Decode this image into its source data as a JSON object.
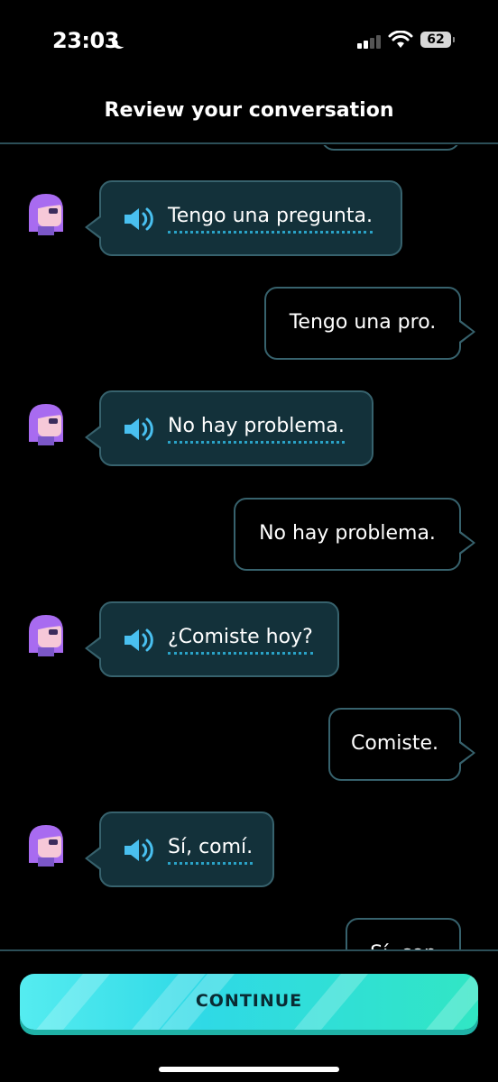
{
  "status_bar": {
    "time": "23:03",
    "battery": "62"
  },
  "header": {
    "title": "Review your conversation"
  },
  "messages": [
    {
      "side": "right",
      "text": ""
    },
    {
      "side": "left",
      "text": "Tengo una pregunta."
    },
    {
      "side": "right",
      "text": "Tengo una pro."
    },
    {
      "side": "left",
      "text": "No hay problema."
    },
    {
      "side": "right",
      "text": "No hay problema."
    },
    {
      "side": "left",
      "text": "¿Comiste hoy?"
    },
    {
      "side": "right",
      "text": "Comiste."
    },
    {
      "side": "left",
      "text": "Sí, comí."
    },
    {
      "side": "right",
      "text": "Sí, con"
    }
  ],
  "continue_button": {
    "label": "CONTINUE"
  },
  "colors": {
    "accent": "#2fd9e6",
    "bubble_border": "#37626d",
    "bubble_bg": "#13313a",
    "avatar": "#a86bf0"
  },
  "icons": {
    "avatar": "character-avatar",
    "speaker": "speaker-icon",
    "moon": "moon-icon",
    "wifi": "wifi-icon"
  }
}
